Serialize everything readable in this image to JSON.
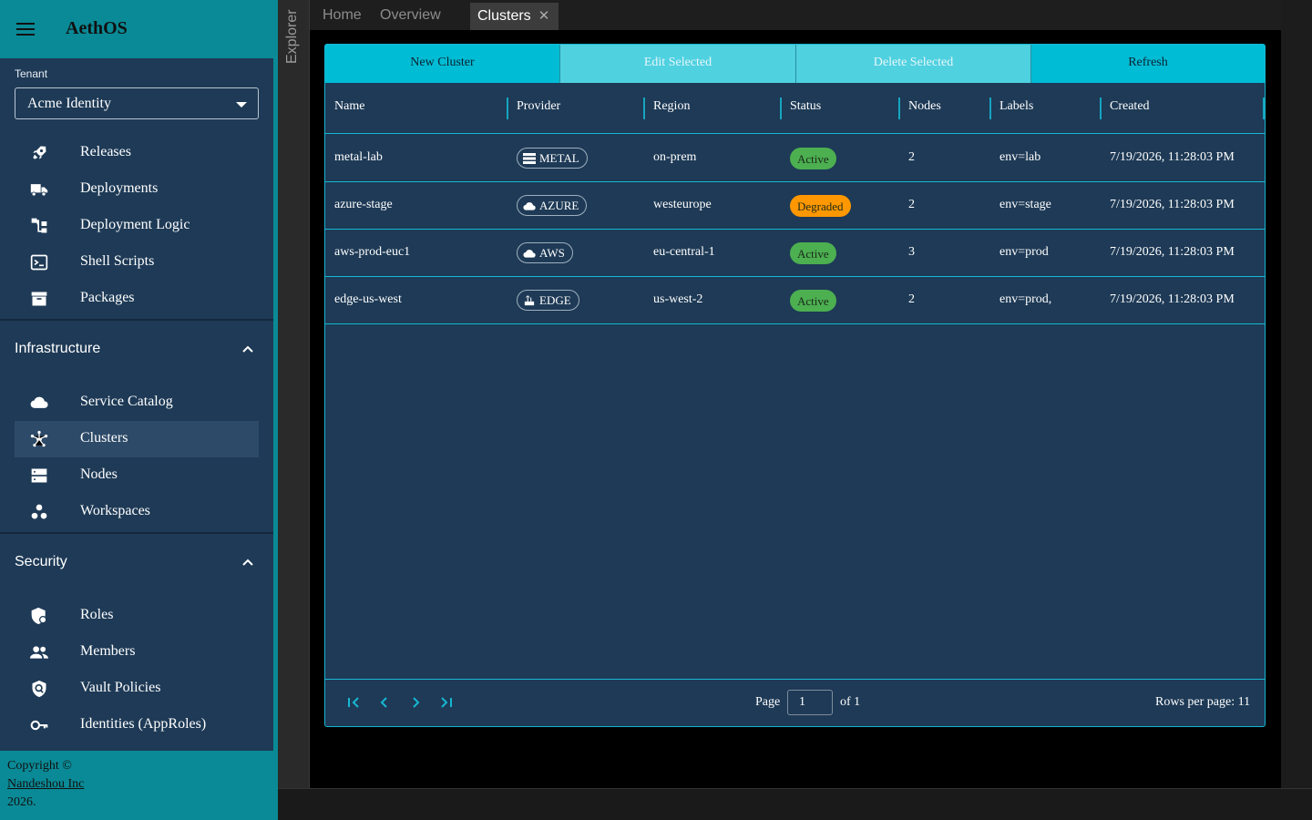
{
  "app": {
    "title": "AethOS"
  },
  "tenant": {
    "label": "Tenant",
    "value": "Acme Identity"
  },
  "nav": {
    "top": [
      {
        "label": "Releases",
        "icon": "rocket-icon"
      },
      {
        "label": "Deployments",
        "icon": "truck-icon"
      },
      {
        "label": "Deployment Logic",
        "icon": "flow-icon"
      },
      {
        "label": "Shell Scripts",
        "icon": "terminal-icon"
      },
      {
        "label": "Packages",
        "icon": "archive-icon"
      }
    ],
    "infrastructure": {
      "title": "Infrastructure",
      "items": [
        {
          "label": "Service Catalog",
          "icon": "cloud-icon"
        },
        {
          "label": "Clusters",
          "icon": "hub-icon",
          "active": true
        },
        {
          "label": "Nodes",
          "icon": "server-icon"
        },
        {
          "label": "Workspaces",
          "icon": "workspaces-icon"
        }
      ]
    },
    "security": {
      "title": "Security",
      "items": [
        {
          "label": "Roles",
          "icon": "shield-lock-icon"
        },
        {
          "label": "Members",
          "icon": "people-icon"
        },
        {
          "label": "Vault Policies",
          "icon": "policy-icon"
        },
        {
          "label": "Identities (AppRoles)",
          "icon": "key-icon"
        }
      ]
    }
  },
  "footer": {
    "line1": "Copyright ©",
    "link": "Nandeshou Inc",
    "line3": "2026."
  },
  "explorer": {
    "label": "Explorer"
  },
  "tabs": [
    {
      "label": "Home"
    },
    {
      "label": "Overview"
    },
    {
      "label": "Clusters",
      "active": true,
      "close": "✕"
    }
  ],
  "toolbar": {
    "new": "New Cluster",
    "edit": "Edit Selected",
    "delete": "Delete Selected",
    "refresh": "Refresh"
  },
  "table": {
    "columns": [
      "Name",
      "Provider",
      "Region",
      "Status",
      "Nodes",
      "Labels",
      "Created"
    ],
    "rows": [
      {
        "name": "metal-lab",
        "provider": "METAL",
        "provider_icon": "list-icon",
        "region": "on-prem",
        "status": "Active",
        "nodes": "2",
        "labels": "env=lab",
        "created": "7/19/2026, 11:28:03 PM"
      },
      {
        "name": "azure-stage",
        "provider": "AZURE",
        "provider_icon": "cloud-icon",
        "region": "westeurope",
        "status": "Degraded",
        "nodes": "2",
        "labels": "env=stage",
        "created": "7/19/2026, 11:28:03 PM"
      },
      {
        "name": "aws-prod-euc1",
        "provider": "AWS",
        "provider_icon": "cloud-icon",
        "region": "eu-central-1",
        "status": "Active",
        "nodes": "3",
        "labels": "env=prod",
        "created": "7/19/2026, 11:28:03 PM"
      },
      {
        "name": "edge-us-west",
        "provider": "EDGE",
        "provider_icon": "router-icon",
        "region": "us-west-2",
        "status": "Active",
        "nodes": "2",
        "labels": "env=prod,",
        "created": "7/19/2026, 11:28:03 PM"
      }
    ]
  },
  "pager": {
    "page_label": "Page",
    "page": "1",
    "of": "of 1",
    "rows_per_page": "Rows per page: 11"
  },
  "colors": {
    "accent": "#00bcd4",
    "sidebar": "#1e3a56",
    "header": "#0a8a96",
    "active": "#4caf50",
    "degraded": "#ff9800"
  }
}
